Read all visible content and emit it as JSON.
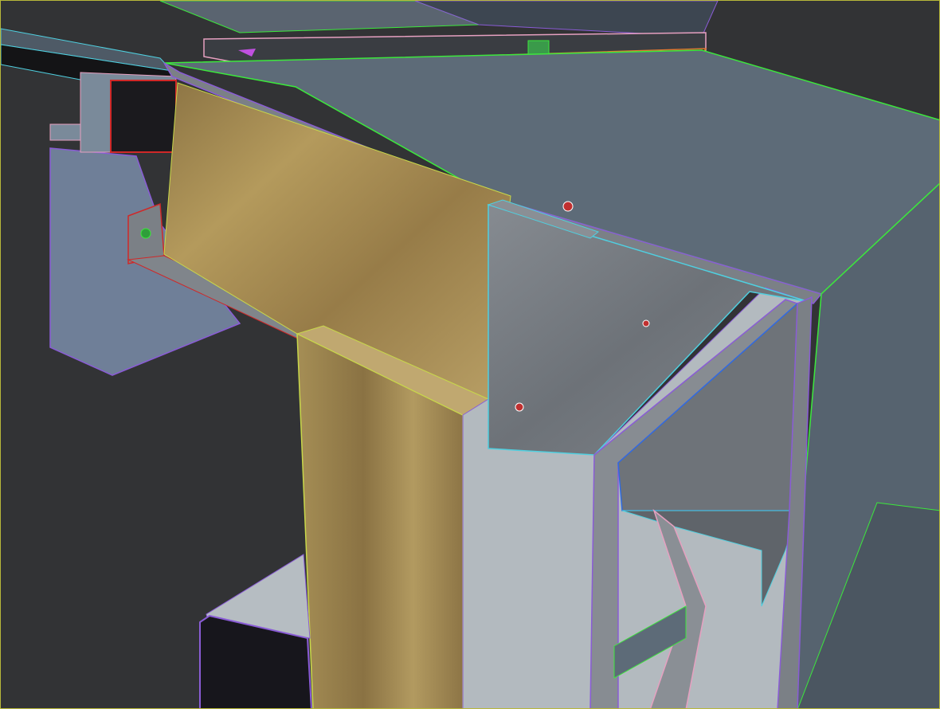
{
  "viewport": {
    "active_border_color": "#b8b83a",
    "background_color": "#323335"
  },
  "materials": {
    "roof_slab": "#5d6b78",
    "insulation_wood": "#a38c52",
    "galvanized_metal": "#7b8086",
    "plaster_wall": "#b3babf",
    "window_frame": "#6f7f98",
    "dark_beam": "#17161c"
  },
  "wire_colors": {
    "green": "#3ce83c",
    "purple": "#8a5cd6",
    "cyan": "#4fd0e0",
    "pink": "#e6a0c0",
    "red": "#d02828",
    "blue": "#2f6be0"
  }
}
